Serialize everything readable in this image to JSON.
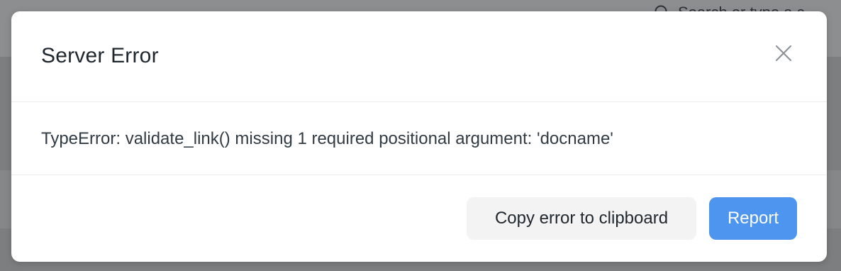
{
  "background": {
    "search_placeholder": "Search or type a c"
  },
  "dialog": {
    "title": "Server Error",
    "message": "TypeError: validate_link() missing 1 required positional argument: 'docname'",
    "buttons": {
      "copy_label": "Copy error to clipboard",
      "report_label": "Report"
    }
  },
  "colors": {
    "primary_button": "#4d95ef",
    "secondary_button": "#f3f3f3",
    "overlay": "#7c7e80"
  },
  "icons": {
    "close": "close-icon",
    "search": "search-icon"
  }
}
